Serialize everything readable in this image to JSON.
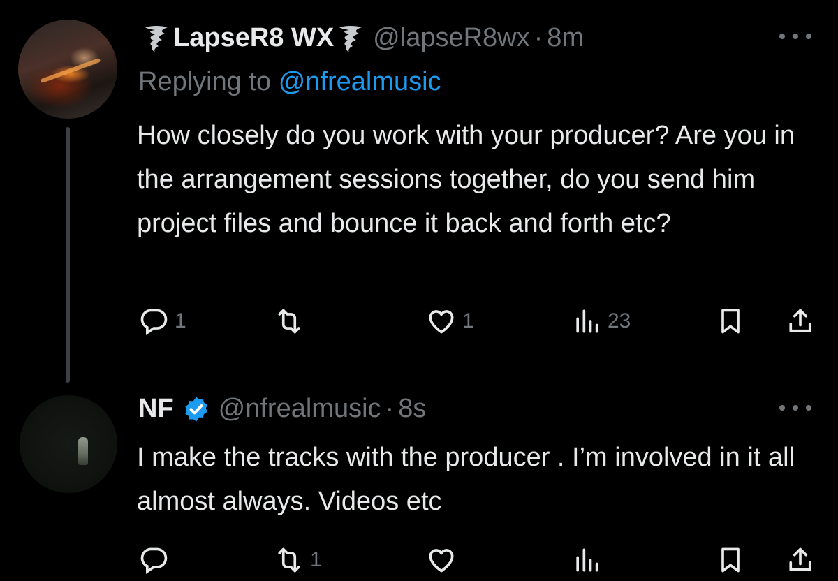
{
  "tweets": [
    {
      "display_name": "LapseR8 WX",
      "name_icons": [
        "tornado-icon",
        "tornado-icon"
      ],
      "handle": "@lapseR8wx",
      "separator": "·",
      "time": "8m",
      "replying_prefix": "Replying to",
      "replying_to": "@nfrealmusic",
      "text": "How closely do you work with your producer? Are you in the arrangement sessions together, do you send him project files and bounce it back and forth etc?",
      "counts": {
        "replies": "1",
        "reposts": "",
        "likes": "1",
        "views": "23"
      }
    },
    {
      "display_name": "NF",
      "name_icons": [
        "verified-badge-icon"
      ],
      "handle": "@nfrealmusic",
      "separator": "·",
      "time": "8s",
      "text": "I make the tracks with the producer . I’m involved in it all almost always. Videos etc",
      "counts": {
        "replies": "",
        "reposts": "1",
        "likes": "",
        "views": ""
      }
    }
  ],
  "colors": {
    "background": "#000000",
    "text": "#e7e9ea",
    "muted": "#71767b",
    "link": "#1d9bf0",
    "verified": "#1d9bf0",
    "thread_line": "#3e4144"
  }
}
